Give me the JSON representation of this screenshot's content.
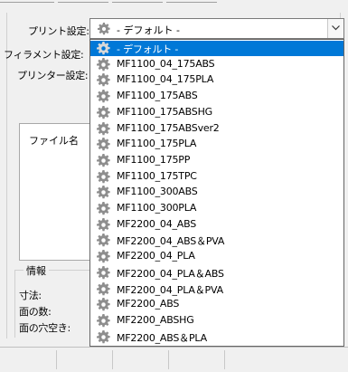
{
  "settings": {
    "print_label": "プリント設定:",
    "filament_label": "フィラメント設定:",
    "printer_label": "プリンター設定:",
    "selected_value": "- デフォルト -"
  },
  "files": {
    "column_header": "ファイル名"
  },
  "info": {
    "legend": "情報",
    "size_label": "寸法:",
    "faces_label": "面の数:",
    "holes_label": "面の穴空き:"
  },
  "dropdown": {
    "options": [
      "- デフォルト -",
      "MF1100_04_175ABS",
      "MF1100_04_175PLA",
      "MF1100_175ABS",
      "MF1100_175ABSHG",
      "MF1100_175ABSver2",
      "MF1100_175PLA",
      "MF1100_175PP",
      "MF1100_175TPC",
      "MF1100_300ABS",
      "MF1100_300PLA",
      "MF2200_04_ABS",
      "MF2200_04_ABS＆PVA",
      "MF2200_04_PLA",
      "MF2200_04_PLA＆ABS",
      "MF2200_04_PLA＆PVA",
      "MF2200_ABS",
      "MF2200_ABSHG",
      "MF2200_ABS＆PLA"
    ],
    "selected_index": 0
  },
  "colors": {
    "highlight": "#0078d7",
    "gear_fill": "#8e8e8e"
  },
  "icons": {
    "option_icon": "gear-icon",
    "combo_arrow": "chevron-down-icon"
  }
}
